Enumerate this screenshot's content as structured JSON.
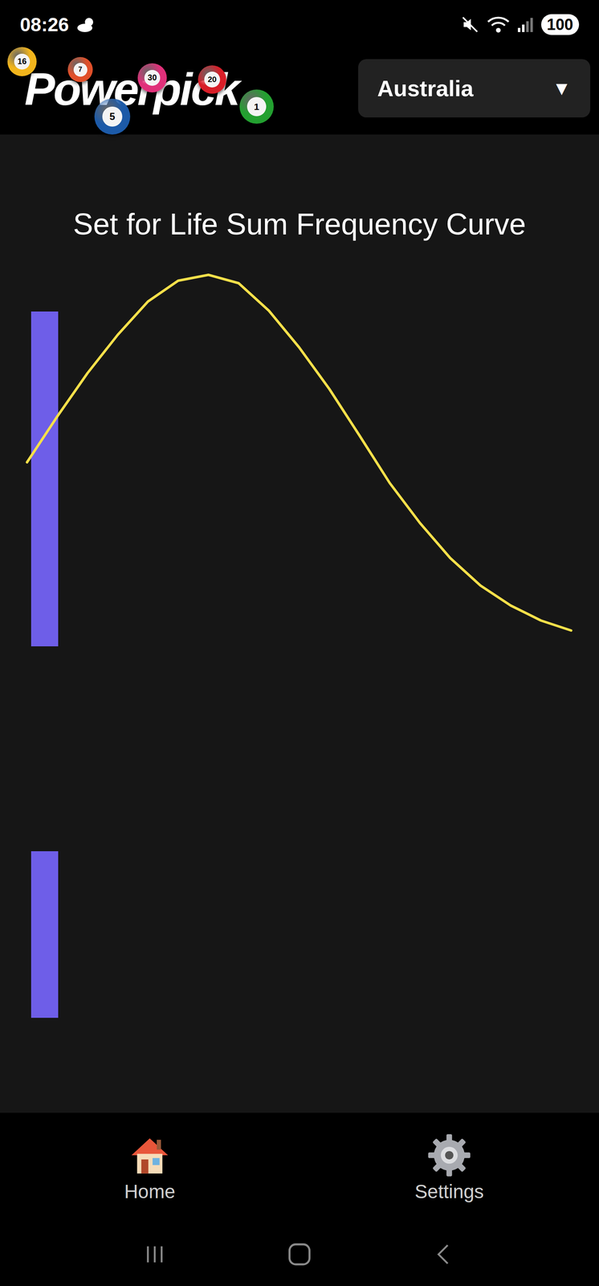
{
  "status_bar": {
    "time": "08:26",
    "battery": "100"
  },
  "logo": {
    "text": "Powerpick",
    "balls": [
      {
        "number": "16",
        "color": "#f2b51c"
      },
      {
        "number": "7",
        "color": "#e0502a"
      },
      {
        "number": "30",
        "color": "#e0307a"
      },
      {
        "number": "20",
        "color": "#d81e28"
      },
      {
        "number": "5",
        "color": "#1c5aa8"
      },
      {
        "number": "1",
        "color": "#23a030"
      }
    ]
  },
  "country_select": {
    "value": "Australia",
    "arrow": "▼"
  },
  "chart": {
    "title": "Set for Life Sum Frequency Curve",
    "curve": [
      680,
      735,
      787,
      833,
      873,
      898,
      905,
      895,
      862,
      818,
      768,
      712,
      655,
      607,
      565,
      532,
      508,
      490,
      478
    ],
    "bars": [
      {
        "low": 459,
        "high": 861
      },
      {
        "low": 13,
        "high": 213
      }
    ]
  },
  "nav": [
    {
      "label": "Home"
    },
    {
      "label": "Settings"
    }
  ]
}
